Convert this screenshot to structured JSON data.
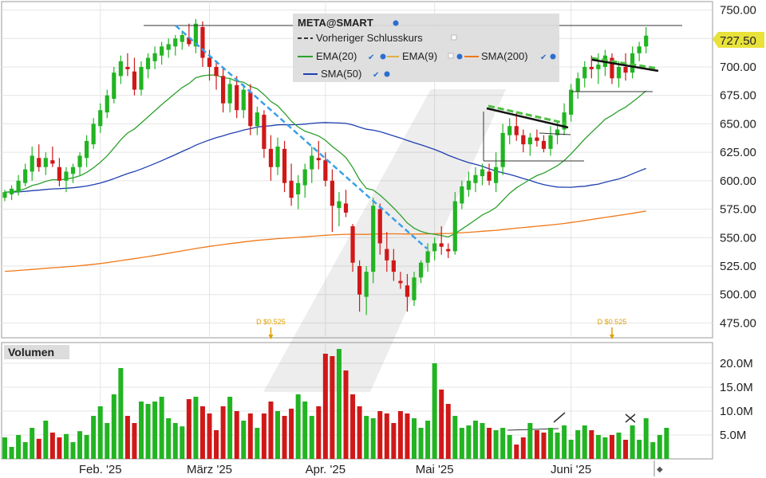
{
  "chart_data": {
    "type": "candlestick",
    "symbol": "META@SMART",
    "current_price_label": "727.50",
    "legend": [
      {
        "name": "Vorheriger Schlusskurs",
        "color": "#333333",
        "style": "dashed"
      },
      {
        "name": "EMA(20)",
        "color": "#2ca02c"
      },
      {
        "name": "EMA(9)",
        "color": "#e0b040"
      },
      {
        "name": "SMA(200)",
        "color": "#f07818"
      },
      {
        "name": "SMA(50)",
        "color": "#1f3fb0"
      }
    ],
    "y_ticks": [
      475,
      500,
      525,
      550,
      575,
      600,
      625,
      650,
      675,
      700,
      725,
      750
    ],
    "y_tick_labels": [
      "475.00",
      "500.00",
      "525.00",
      "550.00",
      "575.00",
      "600.00",
      "625.00",
      "650.00",
      "675.00",
      "700.00",
      "725.00",
      "750.00"
    ],
    "ylim": [
      462,
      756
    ],
    "x_labels": [
      "Feb. '25",
      "März '25",
      "Apr. '25",
      "Mai '25",
      "Juni '25"
    ],
    "x_label_index": [
      14,
      30,
      47,
      63,
      83
    ],
    "dividends": [
      {
        "label": "D $0.525",
        "index": 39
      },
      {
        "label": "D $0.525",
        "index": 89
      }
    ],
    "volume_title": "Volumen",
    "volume_ticks": [
      5,
      10,
      15,
      20
    ],
    "volume_tick_labels": [
      "5.0M",
      "10.0M",
      "15.0M",
      "20.0M"
    ],
    "volume_lim": [
      0,
      24
    ],
    "ohlc": [
      [
        585,
        592,
        582,
        590
      ],
      [
        588,
        596,
        583,
        593
      ],
      [
        590,
        605,
        587,
        600
      ],
      [
        598,
        615,
        595,
        610
      ],
      [
        608,
        630,
        600,
        622
      ],
      [
        620,
        632,
        608,
        612
      ],
      [
        612,
        625,
        605,
        620
      ],
      [
        618,
        630,
        612,
        615
      ],
      [
        612,
        620,
        595,
        600
      ],
      [
        600,
        612,
        590,
        608
      ],
      [
        606,
        615,
        598,
        612
      ],
      [
        612,
        625,
        605,
        622
      ],
      [
        620,
        640,
        612,
        635
      ],
      [
        632,
        655,
        628,
        650
      ],
      [
        648,
        668,
        642,
        662
      ],
      [
        660,
        680,
        655,
        675
      ],
      [
        672,
        700,
        668,
        695
      ],
      [
        692,
        710,
        685,
        705
      ],
      [
        700,
        712,
        692,
        698
      ],
      [
        696,
        708,
        675,
        680
      ],
      [
        680,
        705,
        675,
        700
      ],
      [
        698,
        712,
        690,
        708
      ],
      [
        705,
        718,
        698,
        712
      ],
      [
        710,
        722,
        702,
        718
      ],
      [
        715,
        725,
        708,
        720
      ],
      [
        718,
        728,
        710,
        725
      ],
      [
        722,
        732,
        715,
        728
      ],
      [
        726,
        738,
        718,
        720
      ],
      [
        718,
        742,
        712,
        738
      ],
      [
        735,
        740,
        700,
        708
      ],
      [
        708,
        715,
        688,
        700
      ],
      [
        700,
        705,
        680,
        692
      ],
      [
        692,
        700,
        660,
        668
      ],
      [
        668,
        690,
        660,
        685
      ],
      [
        684,
        692,
        655,
        662
      ],
      [
        662,
        685,
        655,
        680
      ],
      [
        678,
        685,
        640,
        648
      ],
      [
        648,
        665,
        640,
        660
      ],
      [
        658,
        662,
        620,
        628
      ],
      [
        628,
        640,
        600,
        612
      ],
      [
        612,
        638,
        605,
        630
      ],
      [
        628,
        635,
        590,
        598
      ],
      [
        600,
        615,
        578,
        585
      ],
      [
        588,
        605,
        575,
        598
      ],
      [
        596,
        615,
        585,
        610
      ],
      [
        610,
        630,
        598,
        622
      ],
      [
        620,
        635,
        610,
        618
      ],
      [
        618,
        625,
        595,
        600
      ],
      [
        600,
        610,
        555,
        578
      ],
      [
        576,
        590,
        560,
        582
      ],
      [
        580,
        592,
        568,
        572
      ],
      [
        560,
        562,
        520,
        528
      ],
      [
        525,
        530,
        485,
        500
      ],
      [
        498,
        525,
        482,
        520
      ],
      [
        520,
        585,
        510,
        578
      ],
      [
        575,
        580,
        535,
        545
      ],
      [
        540,
        555,
        520,
        530
      ],
      [
        530,
        540,
        512,
        520
      ],
      [
        512,
        520,
        505,
        510
      ],
      [
        508,
        518,
        485,
        498
      ],
      [
        495,
        520,
        490,
        515
      ],
      [
        515,
        530,
        510,
        528
      ],
      [
        528,
        545,
        520,
        538
      ],
      [
        538,
        550,
        530,
        545
      ],
      [
        545,
        560,
        535,
        542
      ],
      [
        540,
        545,
        532,
        538
      ],
      [
        538,
        590,
        535,
        582
      ],
      [
        580,
        600,
        575,
        595
      ],
      [
        592,
        608,
        586,
        600
      ],
      [
        598,
        612,
        590,
        605
      ],
      [
        604,
        615,
        596,
        610
      ],
      [
        608,
        615,
        596,
        600
      ],
      [
        598,
        625,
        590,
        612
      ],
      [
        612,
        650,
        605,
        642
      ],
      [
        640,
        655,
        632,
        648
      ],
      [
        648,
        660,
        635,
        640
      ],
      [
        640,
        645,
        625,
        632
      ],
      [
        632,
        642,
        622,
        638
      ],
      [
        638,
        645,
        630,
        635
      ],
      [
        635,
        640,
        625,
        628
      ],
      [
        628,
        648,
        622,
        640
      ],
      [
        640,
        652,
        632,
        645
      ],
      [
        645,
        668,
        640,
        660
      ],
      [
        658,
        685,
        652,
        680
      ],
      [
        678,
        695,
        672,
        690
      ],
      [
        690,
        705,
        682,
        700
      ],
      [
        700,
        710,
        690,
        698
      ],
      [
        698,
        712,
        685,
        702
      ],
      [
        700,
        715,
        692,
        710
      ],
      [
        708,
        712,
        685,
        690
      ],
      [
        690,
        705,
        682,
        700
      ],
      [
        700,
        712,
        688,
        695
      ],
      [
        695,
        718,
        690,
        712
      ],
      [
        712,
        722,
        705,
        718
      ],
      [
        718,
        735,
        712,
        727.5
      ]
    ],
    "volume": [
      4.5,
      2.5,
      5.0,
      3.5,
      6.5,
      4.2,
      8.0,
      5.5,
      4.5,
      5.2,
      3.5,
      5.8,
      5.0,
      9.0,
      11.0,
      7.5,
      13.5,
      19.0,
      9.0,
      7.5,
      12.0,
      11.5,
      12.0,
      13.0,
      8.5,
      7.5,
      6.8,
      12.5,
      13.0,
      11.0,
      9.5,
      6.0,
      11.0,
      13.0,
      10.0,
      8.0,
      9.5,
      6.5,
      9.5,
      12.0,
      10.0,
      9.0,
      10.5,
      13.5,
      12.0,
      9.0,
      11.0,
      22.0,
      21.5,
      23.0,
      18.5,
      13.5,
      11.0,
      9.0,
      8.5,
      10.0,
      9.5,
      7.5,
      10.0,
      9.5,
      8.5,
      6.5,
      8.0,
      20.0,
      14.5,
      11.5,
      9.0,
      6.5,
      7.0,
      8.0,
      7.5,
      6.5,
      6.0,
      6.5,
      5.0,
      3.0,
      4.5,
      7.5,
      6.0,
      5.5,
      6.5,
      5.5,
      7.0,
      4.0,
      6.0,
      7.0,
      6.0,
      5.0,
      4.5,
      5.0,
      5.5,
      4.0,
      7.0,
      4.0,
      8.5,
      3.5,
      5.0,
      6.5
    ]
  }
}
